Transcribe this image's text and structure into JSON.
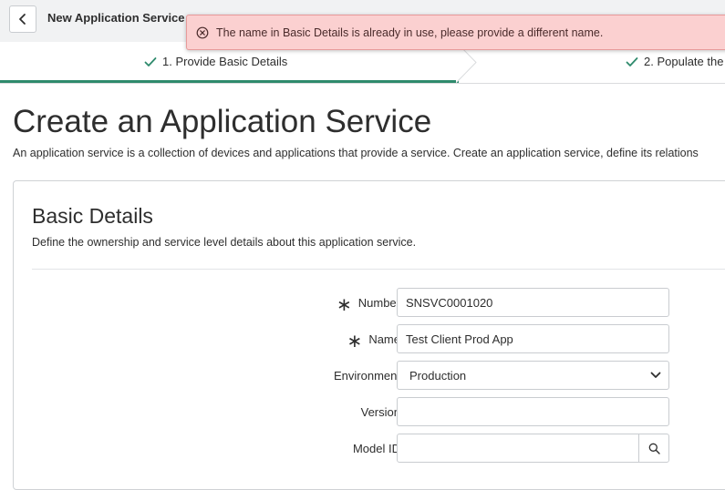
{
  "header": {
    "title": "New Application Service"
  },
  "toast": {
    "message": "The name in Basic Details is already in use, please provide a different name.",
    "icon": "error-circle-icon",
    "color": "#fbd0d0"
  },
  "stepper": {
    "steps": [
      {
        "label": "1. Provide Basic Details",
        "status": "complete"
      },
      {
        "label": "2. Populate the",
        "status": "complete"
      }
    ],
    "accent_color": "#2e8a6c"
  },
  "page": {
    "title": "Create an Application Service",
    "description": "An application service is a collection of devices and applications that provide a service. Create an application service, define its relations"
  },
  "basic_details": {
    "title": "Basic Details",
    "description": "Define the ownership and service level details about this application service.",
    "fields": {
      "number": {
        "label": "Number",
        "value": "SNSVC0001020",
        "required": true
      },
      "name": {
        "label": "Name",
        "value": "Test Client Prod App",
        "required": true
      },
      "environment": {
        "label": "Environment",
        "value": "Production"
      },
      "version": {
        "label": "Version",
        "value": ""
      },
      "model_id": {
        "label": "Model ID",
        "value": ""
      }
    }
  }
}
